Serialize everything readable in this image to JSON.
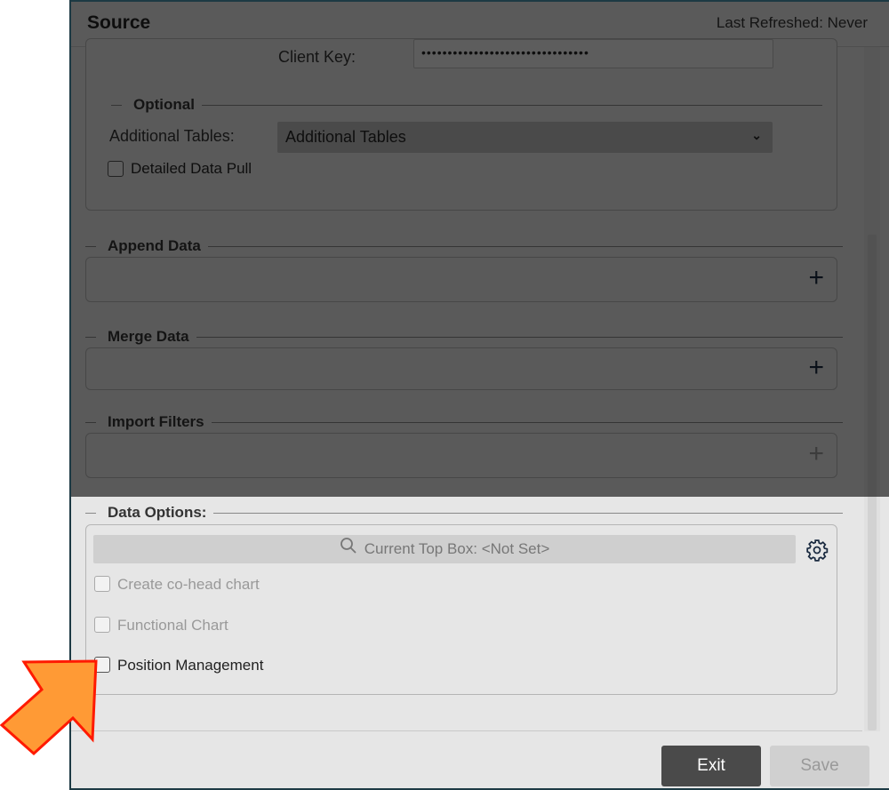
{
  "dialog": {
    "title": "Source",
    "last_refreshed": "Last Refreshed: Never"
  },
  "connection": {
    "client_key_label": "Client Key:",
    "client_key_value": "••••••••••••••••••••••••••••••••"
  },
  "optional": {
    "legend": "Optional",
    "additional_tables_label": "Additional Tables:",
    "additional_tables_value": "Additional Tables",
    "detailed_data_pull_label": "Detailed Data Pull",
    "detailed_data_pull_checked": false
  },
  "append_data": {
    "legend": "Append Data"
  },
  "merge_data": {
    "legend": "Merge Data"
  },
  "import_filters": {
    "legend": "Import Filters",
    "add_disabled": true
  },
  "data_options": {
    "legend": "Data Options:",
    "top_box": "Current Top Box: <Not Set>",
    "options": [
      {
        "label": "Create co-head chart",
        "checked": false,
        "disabled": true
      },
      {
        "label": "Functional Chart",
        "checked": false,
        "disabled": true
      },
      {
        "label": "Position Management",
        "checked": false,
        "disabled": false
      }
    ]
  },
  "footer": {
    "exit_label": "Exit",
    "save_label": "Save",
    "save_disabled": true
  },
  "colors": {
    "highlight_arrow": "#ff9a35",
    "arrow_outline": "#ff1a00",
    "dialog_border": "#1d3a44"
  }
}
